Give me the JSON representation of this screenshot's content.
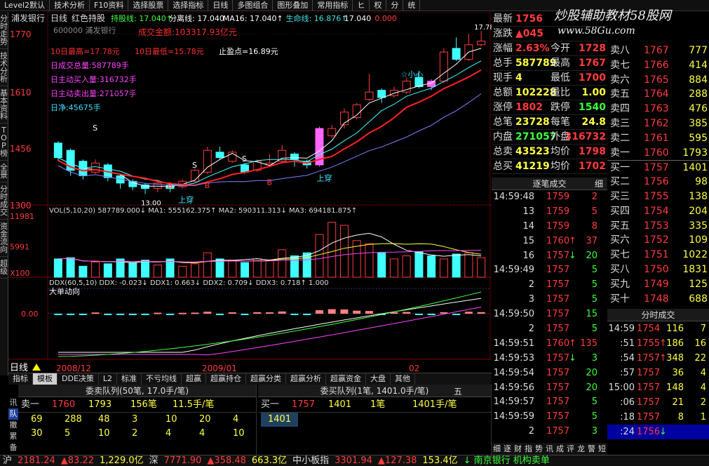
{
  "menubar": [
    "Level2默认",
    "技术分析",
    "F10资料",
    "选择股票",
    "选择指标",
    "日线",
    "多图组合",
    "图形叠加",
    "常用指标",
    "ヒ",
    "权",
    "分",
    "统"
  ],
  "lefttabs": [
    "分时走势",
    "技术分析",
    "基本资料",
    "TOP榜",
    "全景",
    "分时成交",
    "资金流向",
    "超级"
  ],
  "chart": {
    "title_name": "浦发银行",
    "title_period": "日线",
    "title_type": "红色持股",
    "ma_labels": [
      {
        "t": "持股线: 17.040↑",
        "c": "#40ff40"
      },
      {
        "t": "分离线: 17.040",
        "c": "#ffffff"
      },
      {
        "t": "MA16: 17.040↑",
        "c": "#ffffff"
      },
      {
        "t": "生命线: 16.876↑",
        "c": "#40e0e0"
      },
      {
        "t": "17.040",
        "c": "#ffffff"
      },
      {
        "t": "0.000",
        "c": "#ff4040"
      }
    ],
    "code": "600000 浦发银行",
    "ann_total": "成交金额:103317.93亿元",
    "ann_high": "10日最高=17.78元",
    "ann_low": "10日最低=15.78元",
    "ann_stop": "止盈点=16.89元",
    "ann_vol": "日成交总量:587789手",
    "ann_buy": "日主动买入量:316732手",
    "ann_sell": "日主动卖出量:271057手",
    "ann_net": "日净:45675手",
    "price_axis": [
      "1770",
      "1610",
      "1456",
      "1300"
    ],
    "hi_label": "17.78",
    "lo_label": "13.00",
    "sig_up1": "上穿",
    "sig_up2": "上穿",
    "sig_s1": "S",
    "sig_s2": "S",
    "sig_s3": "S",
    "sig_b1": "B",
    "sig_b2": "B",
    "sig_b3": "B",
    "sig_star": "☆小心",
    "vol_labels": "VOL(5,10,20)  587789.000↓  MA1: 555162.375↑  MA2: 590311.313↓  MA3: 694181.875↑",
    "vol_axis": [
      "11981",
      "5991",
      "X100"
    ],
    "ddx_labels": "DDX(60,5,10)  DDX: -0.023↓  DDX1: 0.663↓  DDX2: 0.709↓  DDX3: 0.718↑  1.000",
    "ddx_title": "大单动向",
    "ddx_axis": "0.00",
    "date_axis": [
      "2008/12",
      "2009/01",
      "02"
    ],
    "period_label": "日线",
    "candles": [
      {
        "o": 1470,
        "c": 1430,
        "h": 1475,
        "l": 1420,
        "up": false
      },
      {
        "o": 1450,
        "c": 1395,
        "h": 1455,
        "l": 1380,
        "up": false
      },
      {
        "o": 1420,
        "c": 1380,
        "h": 1425,
        "l": 1370,
        "up": false
      },
      {
        "o": 1390,
        "c": 1415,
        "h": 1425,
        "l": 1385,
        "up": true
      },
      {
        "o": 1410,
        "c": 1375,
        "h": 1415,
        "l": 1365,
        "up": false
      },
      {
        "o": 1380,
        "c": 1360,
        "h": 1385,
        "l": 1345,
        "up": false
      },
      {
        "o": 1365,
        "c": 1350,
        "h": 1370,
        "l": 1340,
        "up": false
      },
      {
        "o": 1355,
        "c": 1345,
        "h": 1360,
        "l": 1330,
        "up": false
      },
      {
        "o": 1345,
        "c": 1360,
        "h": 1365,
        "l": 1335,
        "up": true
      },
      {
        "o": 1355,
        "c": 1345,
        "h": 1360,
        "l": 1335,
        "up": false
      },
      {
        "o": 1350,
        "c": 1365,
        "h": 1370,
        "l": 1345,
        "up": true
      },
      {
        "o": 1365,
        "c": 1395,
        "h": 1400,
        "l": 1360,
        "up": true
      },
      {
        "o": 1390,
        "c": 1450,
        "h": 1460,
        "l": 1385,
        "up": true
      },
      {
        "o": 1445,
        "c": 1430,
        "h": 1460,
        "l": 1425,
        "up": false
      },
      {
        "o": 1420,
        "c": 1445,
        "h": 1450,
        "l": 1415,
        "up": true
      },
      {
        "o": 1410,
        "c": 1390,
        "h": 1415,
        "l": 1385,
        "up": false
      },
      {
        "o": 1395,
        "c": 1420,
        "h": 1425,
        "l": 1390,
        "up": true
      },
      {
        "o": 1410,
        "c": 1415,
        "h": 1440,
        "l": 1405,
        "up": true
      },
      {
        "o": 1420,
        "c": 1450,
        "h": 1465,
        "l": 1415,
        "up": true
      },
      {
        "o": 1440,
        "c": 1425,
        "h": 1445,
        "l": 1405,
        "up": false
      },
      {
        "o": 1420,
        "c": 1410,
        "h": 1425,
        "l": 1400,
        "up": false
      },
      {
        "o": 1410,
        "c": 1510,
        "h": 1515,
        "l": 1405,
        "up": true,
        "mag": true
      },
      {
        "o": 1490,
        "c": 1510,
        "h": 1520,
        "l": 1485,
        "up": true
      },
      {
        "o": 1520,
        "c": 1555,
        "h": 1565,
        "l": 1510,
        "up": true
      },
      {
        "o": 1540,
        "c": 1575,
        "h": 1580,
        "l": 1535,
        "up": true
      },
      {
        "o": 1590,
        "c": 1610,
        "h": 1660,
        "l": 1585,
        "up": true
      },
      {
        "o": 1615,
        "c": 1595,
        "h": 1620,
        "l": 1580,
        "up": false
      },
      {
        "o": 1600,
        "c": 1615,
        "h": 1625,
        "l": 1595,
        "up": true
      },
      {
        "o": 1610,
        "c": 1640,
        "h": 1650,
        "l": 1605,
        "up": true
      },
      {
        "o": 1650,
        "c": 1625,
        "h": 1665,
        "l": 1620,
        "up": false
      },
      {
        "o": 1625,
        "c": 1640,
        "h": 1645,
        "l": 1615,
        "up": false,
        "mag": true
      },
      {
        "o": 1640,
        "c": 1720,
        "h": 1730,
        "l": 1635,
        "up": true
      },
      {
        "o": 1730,
        "c": 1700,
        "h": 1760,
        "l": 1695,
        "up": false
      },
      {
        "o": 1700,
        "c": 1740,
        "h": 1770,
        "l": 1695,
        "up": true
      },
      {
        "o": 1740,
        "c": 1750,
        "h": 1778,
        "l": 1735,
        "up": true
      }
    ],
    "vols": [
      30,
      32,
      18,
      25,
      22,
      30,
      24,
      28,
      20,
      30,
      18,
      22,
      40,
      30,
      28,
      24,
      30,
      28,
      45,
      35,
      40,
      70,
      90,
      85,
      60,
      55,
      40,
      30,
      35,
      42,
      35,
      30,
      38,
      40,
      32
    ],
    "vols_up": [
      false,
      false,
      false,
      true,
      false,
      false,
      false,
      false,
      true,
      false,
      true,
      true,
      true,
      false,
      true,
      false,
      true,
      true,
      true,
      false,
      false,
      true,
      true,
      true,
      true,
      true,
      false,
      true,
      true,
      false,
      false,
      true,
      false,
      true,
      true
    ]
  },
  "watermark": "炒股辅助教材58股网",
  "watermark_url": "www.58Gu.com",
  "quote": [
    {
      "l": "最新",
      "v": "1756",
      "vc": "#ff3c3c",
      "l2": "",
      "v2": ""
    },
    {
      "l": "涨跌",
      "v": "▲045",
      "vc": "#ff3c3c",
      "l2": "",
      "v2": ""
    },
    {
      "l": "涨幅",
      "v": "2.63%",
      "vc": "#ff3c3c",
      "l2": "今开",
      "v2": "1728",
      "v2c": "#ff3c3c"
    },
    {
      "l": "总手",
      "v": "587789",
      "vc": "#ffff44",
      "l2": "最高",
      "v2": "1767",
      "v2c": "#ff3c3c"
    },
    {
      "l": "现手",
      "v": "4",
      "vc": "#ffff44",
      "l2": "最低",
      "v2": "1700",
      "v2c": "#ff3c3c"
    },
    {
      "l": "总额",
      "v": "102228",
      "vc": "#ffff44",
      "l2": "量比",
      "v2": "1.00",
      "v2c": "#ffff44"
    },
    {
      "l": "涨停",
      "v": "1802",
      "vc": "#ff3c3c",
      "l2": "跌停",
      "v2": "1540",
      "v2c": "#3cff3c"
    },
    {
      "l": "总笔",
      "v": "23728",
      "vc": "#ffff44",
      "l2": "每笔",
      "v2": "24.8",
      "v2c": "#ffff44"
    },
    {
      "l": "内盘",
      "v": "271057",
      "vc": "#3cff3c",
      "l2": "外盘",
      "v2": "316732",
      "v2c": "#ff3c3c"
    },
    {
      "l": "总卖",
      "v": "43523",
      "vc": "#ffff44",
      "l2": "均价",
      "v2": "1798",
      "v2c": "#ff3c3c"
    },
    {
      "l": "总买",
      "v": "41219",
      "vc": "#ffff44",
      "l2": "均价",
      "v2": "1702",
      "v2c": "#ff3c3c"
    }
  ],
  "depth": [
    {
      "l": "卖八",
      "p": "1767",
      "q": "777"
    },
    {
      "l": "卖七",
      "p": "1766",
      "q": "414"
    },
    {
      "l": "卖六",
      "p": "1765",
      "q": "884"
    },
    {
      "l": "卖五",
      "p": "1764",
      "q": "288"
    },
    {
      "l": "卖四",
      "p": "1763",
      "q": "476"
    },
    {
      "l": "卖三",
      "p": "1762",
      "q": "385"
    },
    {
      "l": "卖二",
      "p": "1761",
      "q": "595"
    },
    {
      "l": "卖一",
      "p": "1760",
      "q": "1793"
    },
    {
      "l": "买一",
      "p": "1757",
      "q": "1401"
    },
    {
      "l": "买二",
      "p": "1756",
      "q": "98"
    },
    {
      "l": "买三",
      "p": "1755",
      "q": "138"
    },
    {
      "l": "买四",
      "p": "1754",
      "q": "204"
    },
    {
      "l": "买五",
      "p": "1753",
      "q": "335"
    },
    {
      "l": "买六",
      "p": "1752",
      "q": "109"
    },
    {
      "l": "买七",
      "p": "1751",
      "q": "1022"
    },
    {
      "l": "买八",
      "p": "1750",
      "q": "1831"
    },
    {
      "l": "买九",
      "p": "1749",
      "q": "125"
    },
    {
      "l": "买十",
      "p": "1748",
      "q": "688"
    }
  ],
  "ticks_title": "逐笔成交",
  "ticks_btn": "细",
  "ticks": [
    {
      "t": "14:59:48",
      "p": "1759",
      "a": "",
      "q": "2",
      "qc": "#ff3c3c"
    },
    {
      "t": "13",
      "p": "1759",
      "a": "",
      "q": "5",
      "qc": "#ff3c3c"
    },
    {
      "t": "14",
      "p": "1759",
      "a": "",
      "q": "8",
      "qc": "#ff3c3c"
    },
    {
      "t": "15",
      "p": "1760",
      "a": "↑",
      "q": "37",
      "qc": "#ff3c3c"
    },
    {
      "t": "16",
      "p": "1757",
      "a": "↓",
      "q": "20",
      "qc": "#3cff3c"
    },
    {
      "t": "14:59:49",
      "p": "1757",
      "a": "",
      "q": "5",
      "qc": "#3cff3c"
    },
    {
      "t": "2",
      "p": "1757",
      "a": "",
      "q": "5",
      "qc": "#3cff3c"
    },
    {
      "t": "3",
      "p": "1757",
      "a": "",
      "q": "5",
      "qc": "#3cff3c"
    },
    {
      "t": "14:59:50",
      "p": "1757",
      "a": "",
      "q": "15",
      "qc": "#3cff3c"
    },
    {
      "t": "2",
      "p": "1757",
      "a": "",
      "q": "5",
      "qc": "#3cff3c"
    },
    {
      "t": "14:59:51",
      "p": "1760",
      "a": "↑",
      "q": "135",
      "qc": "#ff3c3c"
    },
    {
      "t": "14:59:53",
      "p": "1757",
      "a": "↓",
      "q": "3",
      "qc": "#3cff3c"
    },
    {
      "t": "14:59:54",
      "p": "1757",
      "a": "",
      "q": "20",
      "qc": "#3cff3c"
    },
    {
      "t": "14:59:56",
      "p": "1757",
      "a": "",
      "q": "20",
      "qc": "#3cff3c"
    },
    {
      "t": "14:59:57",
      "p": "1757",
      "a": "",
      "q": "5",
      "qc": "#3cff3c"
    },
    {
      "t": "14:59:59",
      "p": "1757",
      "a": "",
      "q": "5",
      "qc": "#3cff3c"
    },
    {
      "t": "2",
      "p": "1757",
      "a": "",
      "q": "3",
      "qc": "#3cff3c"
    }
  ],
  "mticks_title": "分时成交",
  "mticks": [
    {
      "t": "14:59",
      "p": "1754",
      "a": "",
      "q": "116",
      "n": "7"
    },
    {
      "t": ":51",
      "p": "1755",
      "a": "↑",
      "q": "186",
      "n": "16"
    },
    {
      "t": ":54",
      "p": "1757",
      "a": "↑",
      "q": "348",
      "n": "22"
    },
    {
      "t": ":57",
      "p": "1757",
      "a": "",
      "q": "36",
      "n": "4"
    },
    {
      "t": "15:00",
      "p": "1757",
      "a": "",
      "q": "148",
      "n": "4"
    },
    {
      "t": ":06",
      "p": "1757",
      "a": "",
      "q": "21",
      "n": "2"
    },
    {
      "t": ":18",
      "p": "1757",
      "a": "",
      "q": "8",
      "n": "1"
    },
    {
      "t": ":24",
      "p": "1756",
      "a": "↓",
      "q": "",
      "n": ""
    }
  ],
  "bottomtabs": [
    "指标",
    "模板",
    "DDE决策",
    "L2",
    "标准",
    "不亏均线",
    "超赢",
    "超赢持仓",
    "超赢分类",
    "超赢分析",
    "超赢资金",
    "大盘",
    "其他"
  ],
  "queue_ask": {
    "title": "委卖队列(50笔, 17.0手/笔)",
    "l": "卖一",
    "p": "1760",
    "q": "1793",
    "n": "156笔",
    "a": "11.5手/笔",
    "rows": [
      [
        "69",
        "288",
        "48",
        "3",
        "10",
        "20",
        "4"
      ],
      [
        "30",
        "5",
        "10",
        "2",
        "4",
        "4",
        "10"
      ]
    ]
  },
  "queue_bid": {
    "title": "委买队列(1笔, 1401.0手/笔)",
    "l": "买一",
    "p": "1757",
    "q": "1401",
    "n": "1笔",
    "a": "1401手/笔",
    "rows": [
      [
        "1401"
      ]
    ]
  },
  "queue_side": [
    "讯",
    "队",
    "撤",
    "累",
    "备"
  ],
  "queue_btn": "五",
  "btmsidetabs": [
    "细",
    "逐",
    "财",
    "指",
    "势",
    "讯",
    "成",
    "评",
    "龙",
    "警",
    "短"
  ],
  "status": [
    {
      "t": "沪",
      "c": "#ddd"
    },
    {
      "t": "2181.24",
      "c": "#ff3c3c"
    },
    {
      "t": "▲83.22",
      "c": "#ff3c3c"
    },
    {
      "t": "1,229.0亿",
      "c": "#ffff44"
    },
    {
      "t": "深",
      "c": "#ddd"
    },
    {
      "t": "7771.90",
      "c": "#ff3c3c"
    },
    {
      "t": "▲358.48",
      "c": "#ff3c3c"
    },
    {
      "t": "663.3亿",
      "c": "#ffff44"
    },
    {
      "t": "中小板指",
      "c": "#ddd"
    },
    {
      "t": "3301.94",
      "c": "#ff3c3c"
    },
    {
      "t": "▲127.38",
      "c": "#ff3c3c"
    },
    {
      "t": "153.4亿",
      "c": "#ffff44"
    },
    {
      "t": "↓ 南京银行 机构卖单",
      "c": "#3cff3c"
    }
  ]
}
